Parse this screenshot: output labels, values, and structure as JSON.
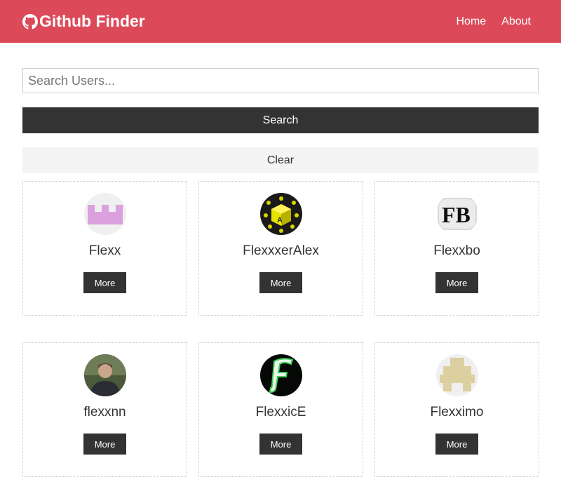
{
  "navbar": {
    "title": "Github Finder",
    "icon": "github-icon",
    "links": [
      "Home",
      "About"
    ],
    "background": "#dc4a5a"
  },
  "search": {
    "placeholder": "Search Users...",
    "value": "",
    "button_label": "Search",
    "clear_label": "Clear"
  },
  "users": [
    {
      "login": "Flexx",
      "avatar": "pink-identicon",
      "more_label": "More"
    },
    {
      "login": "FlexxxerAlex",
      "avatar": "yellow-cube-avatar",
      "more_label": "More"
    },
    {
      "login": "Flexxbo",
      "avatar": "fb-logo-avatar",
      "more_label": "More"
    },
    {
      "login": "flexxnn",
      "avatar": "person-photo-avatar",
      "more_label": "More"
    },
    {
      "login": "FlexxicE",
      "avatar": "green-f-avatar",
      "more_label": "More"
    },
    {
      "login": "Flexximo",
      "avatar": "tan-identicon",
      "more_label": "More"
    }
  ],
  "colors": {
    "dark": "#333333",
    "light": "#f4f4f4",
    "accent": "#dc4a5a"
  }
}
